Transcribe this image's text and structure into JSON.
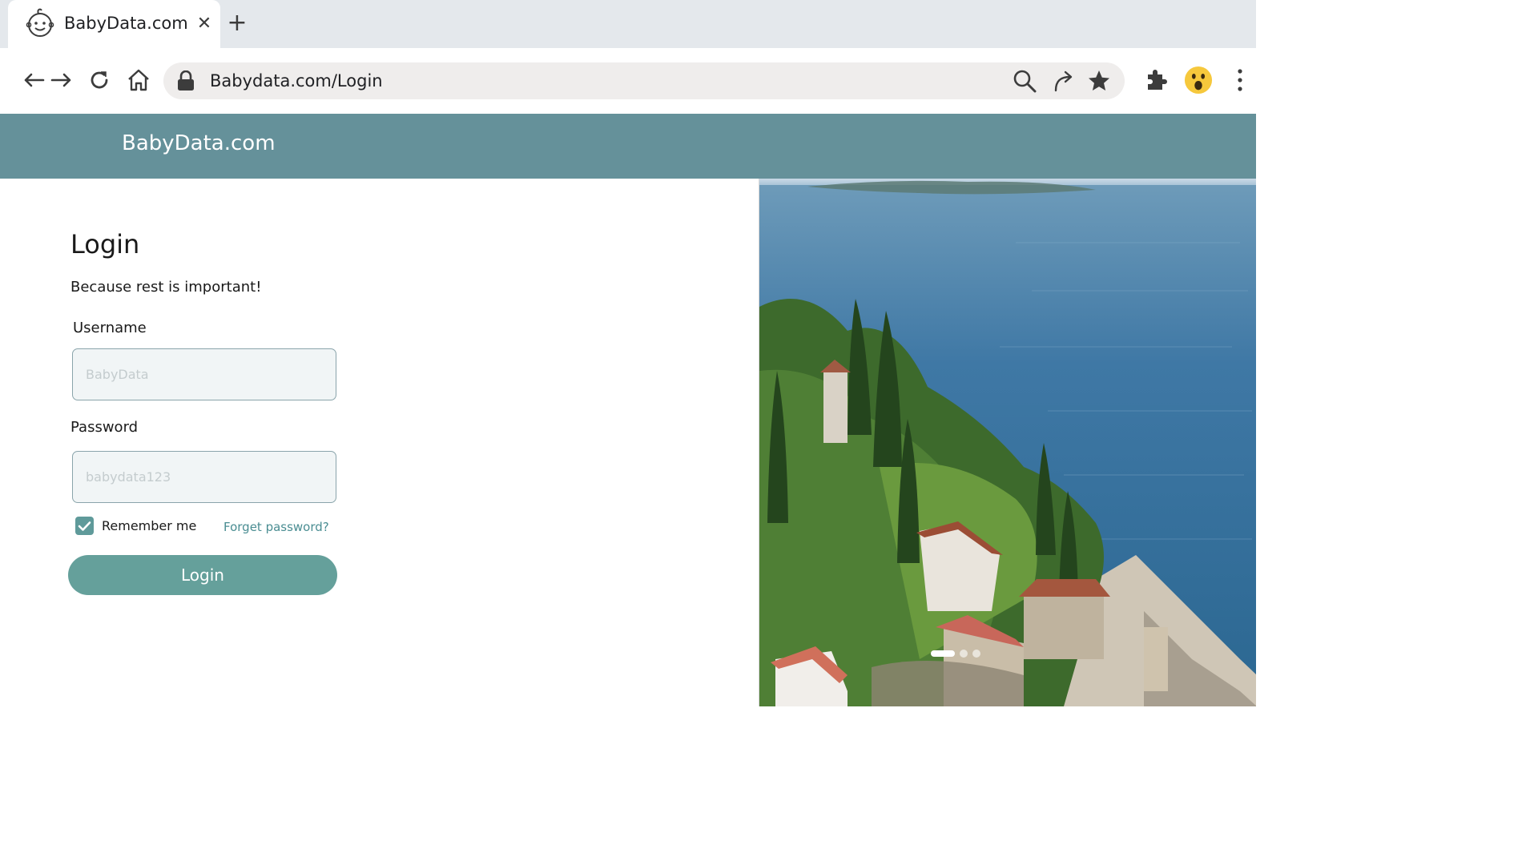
{
  "browser": {
    "tab_title": "BabyData.com",
    "tab_favicon": "baby-face-icon",
    "close_symbol": "✕",
    "new_tab_symbol": "+",
    "url": "Babydata.com/Login"
  },
  "site": {
    "brand": "BabyData.com",
    "header_color": "#65919a",
    "accent_color": "#65a09b"
  },
  "login": {
    "title": "Login",
    "subtitle": "Because rest is important!",
    "username_label": "Username",
    "username_placeholder": "BabyData",
    "password_label": "Password",
    "password_placeholder": "babydata123",
    "remember_label": "Remember me",
    "remember_checked": true,
    "forgot_link": "Forget password?",
    "submit_label": "Login"
  },
  "carousel": {
    "slide_count": 3,
    "active_slide": 1
  }
}
